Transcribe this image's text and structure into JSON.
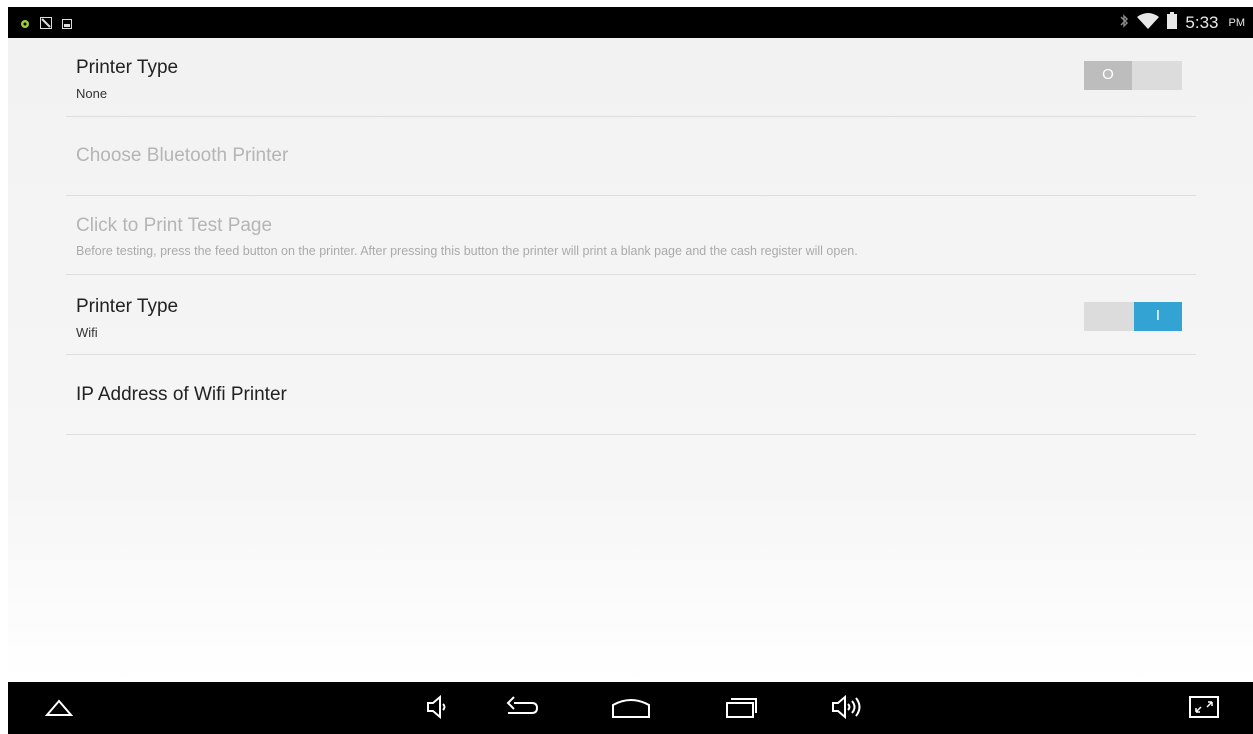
{
  "status_bar": {
    "notification_icons": [
      "android-debug-icon",
      "notification-icon",
      "image-icon"
    ],
    "status_icons": [
      "bluetooth-icon",
      "wifi-icon",
      "battery-icon"
    ],
    "time": "5:33",
    "ampm": "PM"
  },
  "settings": [
    {
      "title": "Printer Type",
      "summary": "None",
      "enabled": true,
      "toggle": {
        "state": "off",
        "glyph": "O"
      }
    },
    {
      "title": "Choose Bluetooth Printer",
      "enabled": false
    },
    {
      "title": "Click to Print Test Page",
      "summary": "Before testing, press the feed button on the printer. After pressing this button the printer will print a blank page and the cash register will open.",
      "enabled": false
    },
    {
      "title": "Printer Type",
      "summary": "Wifi",
      "enabled": true,
      "toggle": {
        "state": "on",
        "glyph": "I"
      }
    },
    {
      "title": "IP Address of Wifi Printer",
      "enabled": true
    }
  ],
  "navigation_bar": {
    "buttons": [
      "hide-bar-icon",
      "volume-down-icon",
      "back-icon",
      "home-icon",
      "recent-apps-icon",
      "volume-up-icon",
      "fullscreen-icon"
    ]
  },
  "colors": {
    "accent": "#33a3d3",
    "toggle_off_thumb": "#bdbdbd",
    "disabled_text": "#b5b5b5"
  }
}
